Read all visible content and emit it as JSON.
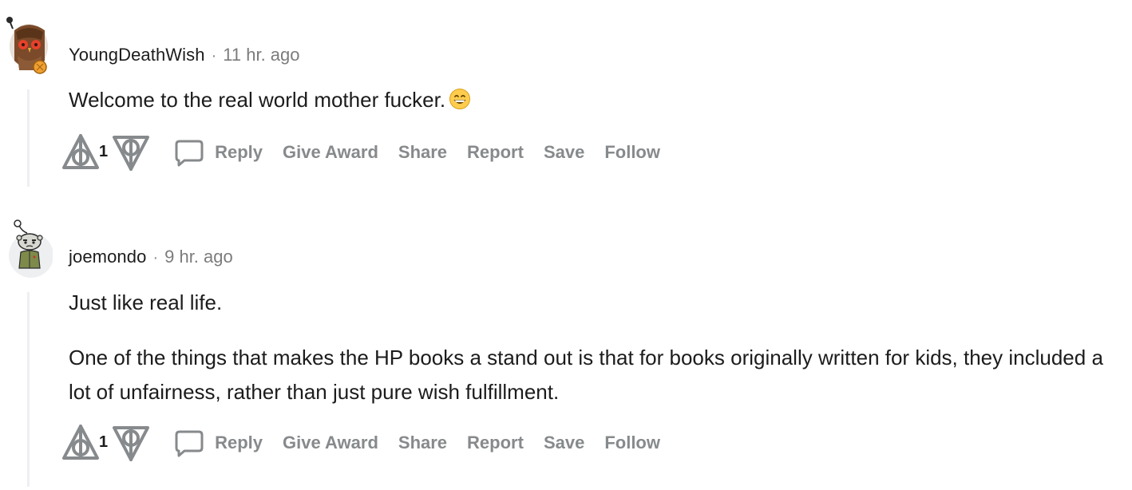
{
  "comments": [
    {
      "username": "YoungDeathWish",
      "separator": "·",
      "time": "11 hr. ago",
      "paragraphs": [
        "Welcome to the real world mother fucker."
      ],
      "emoji": "grinning-face-icon",
      "votes": "1",
      "actions": {
        "reply": "Reply",
        "give_award": "Give Award",
        "share": "Share",
        "report": "Report",
        "save": "Save",
        "follow": "Follow"
      }
    },
    {
      "username": "joemondo",
      "separator": "·",
      "time": "9 hr. ago",
      "paragraphs": [
        "Just like real life.",
        "One of the things that makes the HP books a stand out is that for books originally written for kids, they included a lot of unfairness, rather than just pure wish fulfillment."
      ],
      "votes": "1",
      "actions": {
        "reply": "Reply",
        "give_award": "Give Award",
        "share": "Share",
        "report": "Report",
        "save": "Save",
        "follow": "Follow"
      }
    }
  ],
  "colors": {
    "text": "#1c1c1c",
    "muted": "#878a8c",
    "thread_line": "#edeff1",
    "icon_stroke": "#878a8c"
  }
}
